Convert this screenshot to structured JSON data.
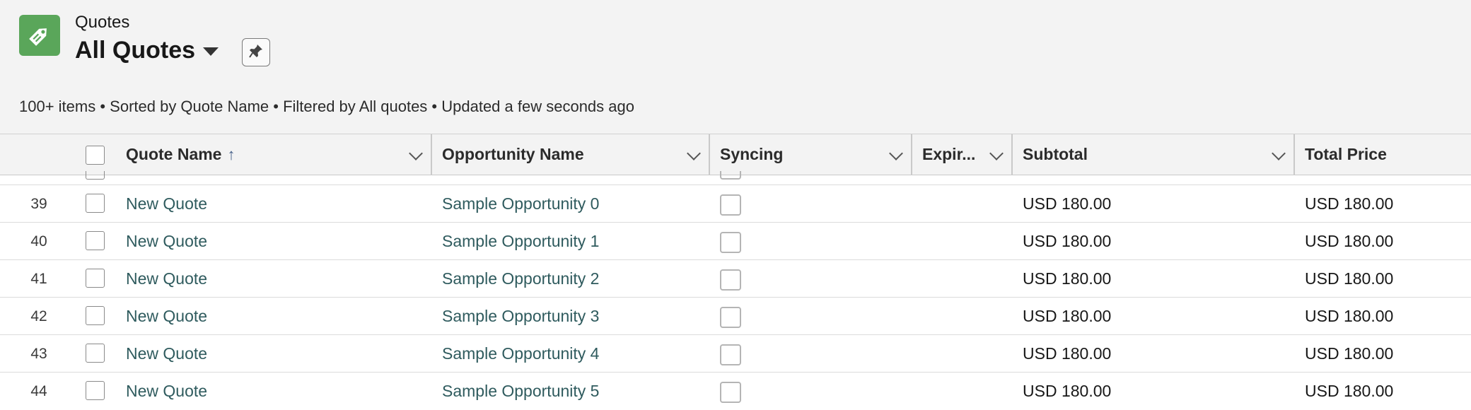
{
  "header": {
    "object_label": "Quotes",
    "list_view_title": "All Quotes",
    "meta": "100+ items • Sorted by Quote Name • Filtered by All quotes • Updated a few seconds ago"
  },
  "table": {
    "columns": [
      {
        "label": "Quote Name",
        "sorted": "ascending"
      },
      {
        "label": "Opportunity Name"
      },
      {
        "label": "Syncing"
      },
      {
        "label": "Expir..."
      },
      {
        "label": "Subtotal"
      },
      {
        "label": "Total Price"
      }
    ],
    "sort_indicator": "↑",
    "rows": [
      {
        "num": "39",
        "quote": "New Quote",
        "opportunity": "Sample Opportunity 0",
        "subtotal": "USD 180.00",
        "total": "USD 180.00"
      },
      {
        "num": "40",
        "quote": "New Quote",
        "opportunity": "Sample Opportunity 1",
        "subtotal": "USD 180.00",
        "total": "USD 180.00"
      },
      {
        "num": "41",
        "quote": "New Quote",
        "opportunity": "Sample Opportunity 2",
        "subtotal": "USD 180.00",
        "total": "USD 180.00"
      },
      {
        "num": "42",
        "quote": "New Quote",
        "opportunity": "Sample Opportunity 3",
        "subtotal": "USD 180.00",
        "total": "USD 180.00"
      },
      {
        "num": "43",
        "quote": "New Quote",
        "opportunity": "Sample Opportunity 4",
        "subtotal": "USD 180.00",
        "total": "USD 180.00"
      },
      {
        "num": "44",
        "quote": "New Quote",
        "opportunity": "Sample Opportunity 5",
        "subtotal": "USD 180.00",
        "total": "USD 180.00"
      }
    ]
  },
  "colors": {
    "app_icon": "#5aa65a",
    "link": "#2f5b5e",
    "header_bg": "#f3f3f3"
  },
  "icons": {
    "app": "price-tag-icon",
    "pin": "pin-icon",
    "dropdown": "caret-down-icon"
  }
}
